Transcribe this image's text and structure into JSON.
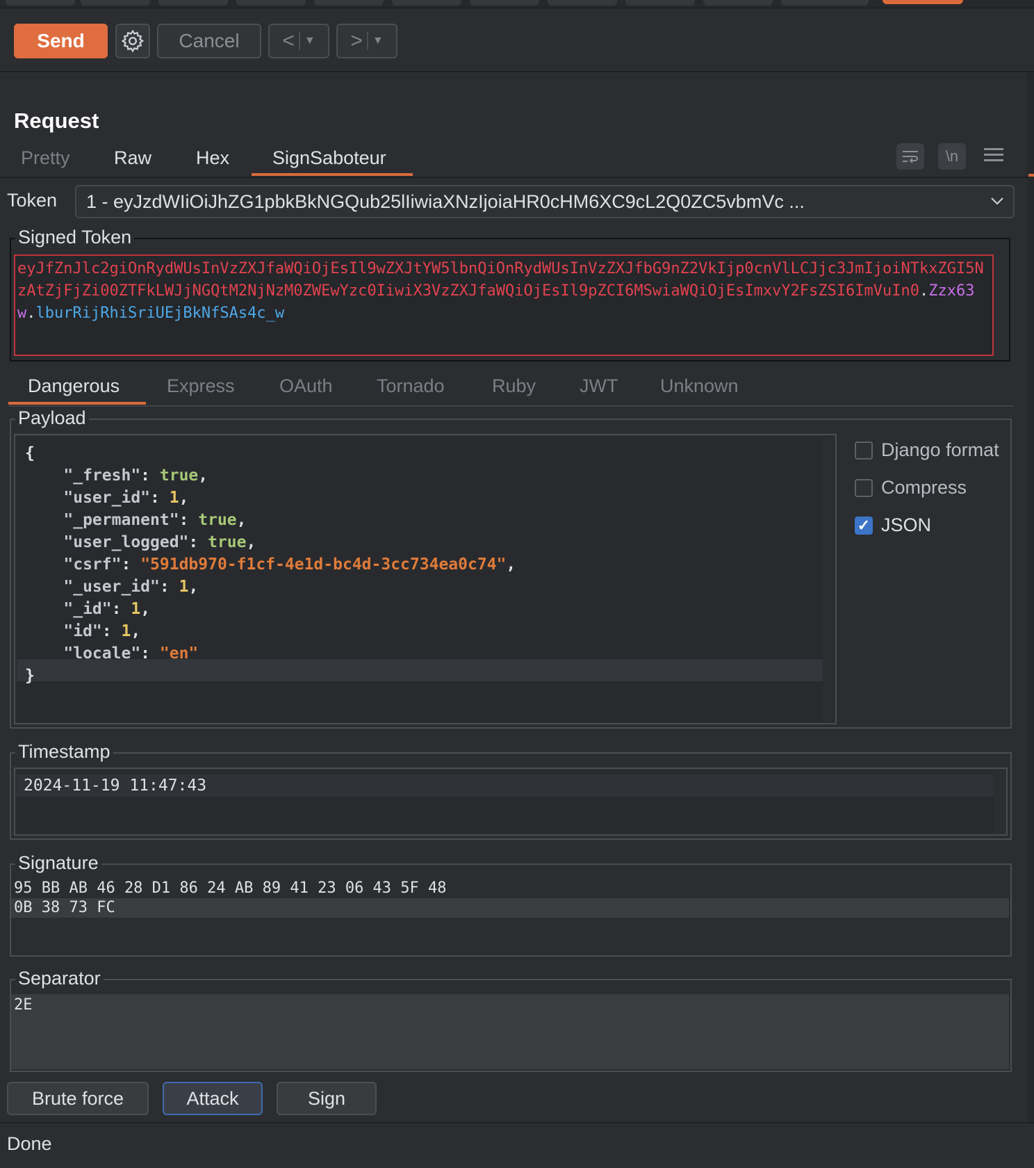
{
  "toolbar": {
    "send_label": "Send",
    "cancel_label": "Cancel",
    "back_label": "<",
    "forward_label": ">"
  },
  "request": {
    "title": "Request",
    "tabs": [
      {
        "label": "Pretty",
        "active": false
      },
      {
        "label": "Raw",
        "active": false
      },
      {
        "label": "Hex",
        "active": false
      },
      {
        "label": "SignSaboteur",
        "active": true
      }
    ],
    "newline_toggle_label": "\\n"
  },
  "token": {
    "label": "Token",
    "selected": "1 - eyJzdWIiOiJhZG1pbkBkNGQub25lIiwiaXNzIjoiaHR0cHM6XC9cL2Q0ZC5vbmVc ..."
  },
  "signed_token": {
    "legend": "Signed Token",
    "payload_part": "eyJfZnJlc2giOnRydWUsInVzZXJfaWQiOjEsIl9wZXJtYW5lbnQiOnRydWUsInVzZXJfbG9nZ2VkIjp0cnVlLCJjc3JmIjoiNTkxZGI5NzAtZjFjZi00ZTFkLWJjNGQtM2NjNzM0ZWEwYzc0IiwiX3VzZXJfaWQiOjEsIl9pZCI6MSwiaWQiOjEsImxvY2FsZSI6ImVuIn0",
    "dot1": ".",
    "timestamp_part": "Zzx63w",
    "dot2": ".",
    "signature_part": "lburRijRhiSriUEjBkNfSAs4c_w",
    "colors": {
      "payload": "#e2424f",
      "timestamp": "#c86fe8",
      "signature": "#4ea8e8"
    }
  },
  "framework_tabs": [
    {
      "label": "Dangerous",
      "active": true
    },
    {
      "label": "Express",
      "active": false
    },
    {
      "label": "OAuth",
      "active": false
    },
    {
      "label": "Tornado",
      "active": false
    },
    {
      "label": "Ruby",
      "active": false
    },
    {
      "label": "JWT",
      "active": false
    },
    {
      "label": "Unknown",
      "active": false
    }
  ],
  "payload": {
    "legend": "Payload",
    "open_brace": "{",
    "close_brace": "}",
    "entries": [
      {
        "key": "\"_fresh\"",
        "value": "true",
        "type": "bool",
        "comma": ","
      },
      {
        "key": "\"user_id\"",
        "value": "1",
        "type": "num",
        "comma": ","
      },
      {
        "key": "\"_permanent\"",
        "value": "true",
        "type": "bool",
        "comma": ","
      },
      {
        "key": "\"user_logged\"",
        "value": "true",
        "type": "bool",
        "comma": ","
      },
      {
        "key": "\"csrf\"",
        "value": "\"591db970-f1cf-4e1d-bc4d-3cc734ea0c74\"",
        "type": "str",
        "comma": ","
      },
      {
        "key": "\"_user_id\"",
        "value": "1",
        "type": "num",
        "comma": ","
      },
      {
        "key": "\"_id\"",
        "value": "1",
        "type": "num",
        "comma": ","
      },
      {
        "key": "\"id\"",
        "value": "1",
        "type": "num",
        "comma": ","
      },
      {
        "key": "\"locale\"",
        "value": "\"en\"",
        "type": "str",
        "comma": ""
      }
    ],
    "options": [
      {
        "label": "Django format",
        "checked": false
      },
      {
        "label": "Compress",
        "checked": false
      },
      {
        "label": "JSON",
        "checked": true
      }
    ]
  },
  "timestamp": {
    "legend": "Timestamp",
    "value": "2024-11-19 11:47:43"
  },
  "signature": {
    "legend": "Signature",
    "line1": "95 BB AB 46 28 D1 86 24 AB 89 41 23 06 43 5F 48",
    "line2": "0B 38 73 FC"
  },
  "separator": {
    "legend": "Separator",
    "value": "2E"
  },
  "actions": {
    "brute_force_label": "Brute force",
    "attack_label": "Attack",
    "sign_label": "Sign"
  },
  "status": {
    "text": "Done"
  },
  "colors": {
    "accent": "#df6d3f",
    "checkbox_on": "#3c74c7",
    "token_border": "#c0343c"
  }
}
